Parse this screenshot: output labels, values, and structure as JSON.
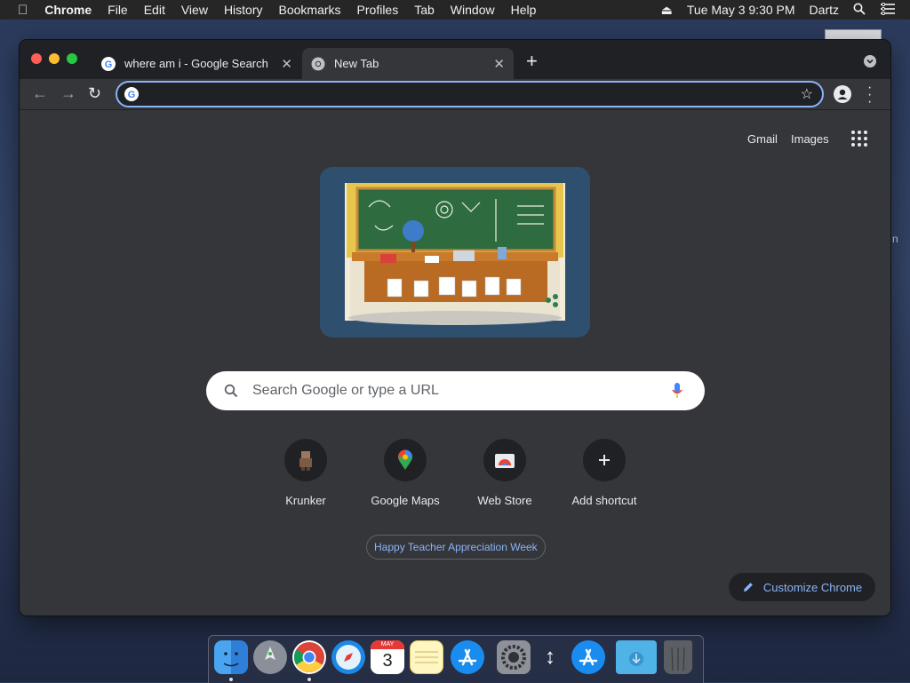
{
  "menubar": {
    "app_name": "Chrome",
    "items": [
      "File",
      "Edit",
      "View",
      "History",
      "Bookmarks",
      "Profiles",
      "Tab",
      "Window",
      "Help"
    ],
    "clock": "Tue May 3  9:30 PM",
    "user": "Dartz"
  },
  "tabs": [
    {
      "title": "where am i - Google Search",
      "active": false
    },
    {
      "title": "New Tab",
      "active": true
    }
  ],
  "omnibox": {
    "value": ""
  },
  "ntp": {
    "top_links": {
      "gmail": "Gmail",
      "images": "Images"
    },
    "search_placeholder": "Search Google or type a URL",
    "shortcuts": [
      {
        "label": "Krunker",
        "icon": "krunker-icon"
      },
      {
        "label": "Google Maps",
        "icon": "maps-pin-icon"
      },
      {
        "label": "Web Store",
        "icon": "webstore-icon"
      },
      {
        "label": "Add shortcut",
        "icon": "plus-icon"
      }
    ],
    "promo": "Happy Teacher Appreciation Week",
    "customize_label": "Customize Chrome"
  },
  "dock": {
    "calendar_month": "MAY",
    "calendar_day": "3",
    "apps": [
      "finder-icon",
      "launchpad-icon",
      "chrome-icon",
      "safari-icon",
      "calendar-icon",
      "notes-icon",
      "app-store-icon",
      "system-preferences-icon",
      "app-store-icon",
      "downloads-folder-icon",
      "trash-icon"
    ]
  },
  "colors": {
    "accent": "#8ab4f8",
    "page_bg": "#35363a",
    "frame": "#202124"
  }
}
